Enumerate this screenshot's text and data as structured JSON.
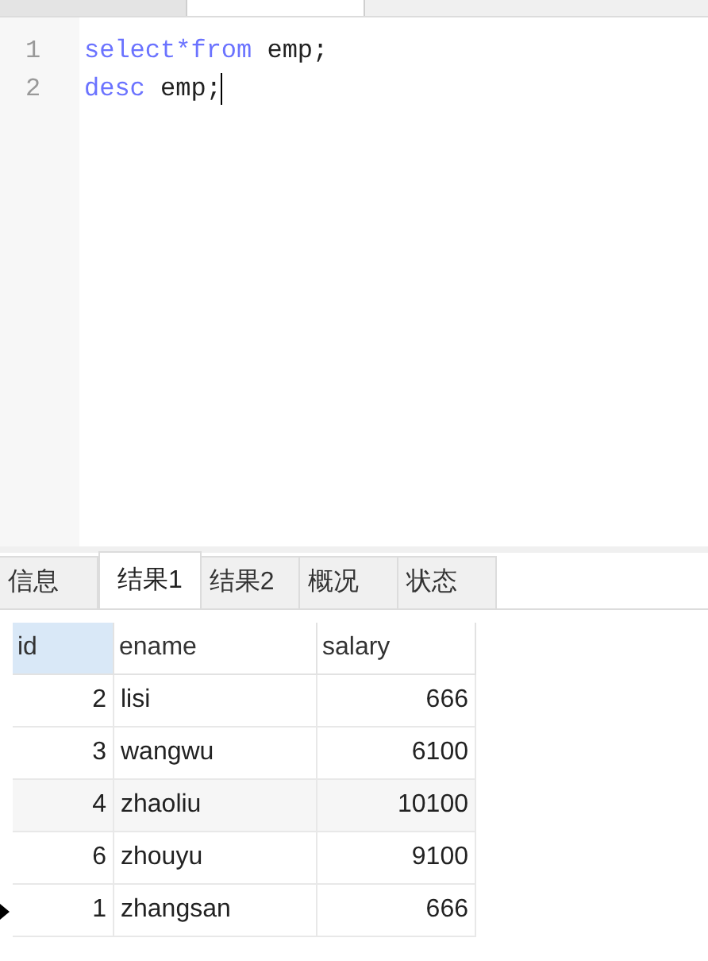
{
  "editor": {
    "lines": [
      {
        "number": "1",
        "tokens": [
          {
            "kind": "keyword",
            "text": "select*from"
          },
          {
            "kind": "plain",
            "text": " emp;"
          }
        ],
        "cursor": false
      },
      {
        "number": "2",
        "tokens": [
          {
            "kind": "keyword",
            "text": "desc"
          },
          {
            "kind": "plain",
            "text": " emp;"
          }
        ],
        "cursor": true
      }
    ]
  },
  "result_tabs": [
    {
      "label": "信息",
      "selected": false
    },
    {
      "label": "结果1",
      "selected": true
    },
    {
      "label": "结果2",
      "selected": false
    },
    {
      "label": "概况",
      "selected": false
    },
    {
      "label": "状态",
      "selected": false
    }
  ],
  "table": {
    "columns": [
      {
        "label": "id",
        "selected": true,
        "kind": "number"
      },
      {
        "label": "ename",
        "selected": false,
        "kind": "text"
      },
      {
        "label": "salary",
        "selected": false,
        "kind": "number"
      }
    ],
    "rows": [
      {
        "cells": [
          "2",
          "lisi",
          "666"
        ],
        "current": false
      },
      {
        "cells": [
          "3",
          "wangwu",
          "6100"
        ],
        "current": false
      },
      {
        "cells": [
          "4",
          "zhaoliu",
          "10100"
        ],
        "current": false
      },
      {
        "cells": [
          "6",
          "zhouyu",
          "9100"
        ],
        "current": false
      },
      {
        "cells": [
          "1",
          "zhangsan",
          "666"
        ],
        "current": true
      }
    ]
  }
}
